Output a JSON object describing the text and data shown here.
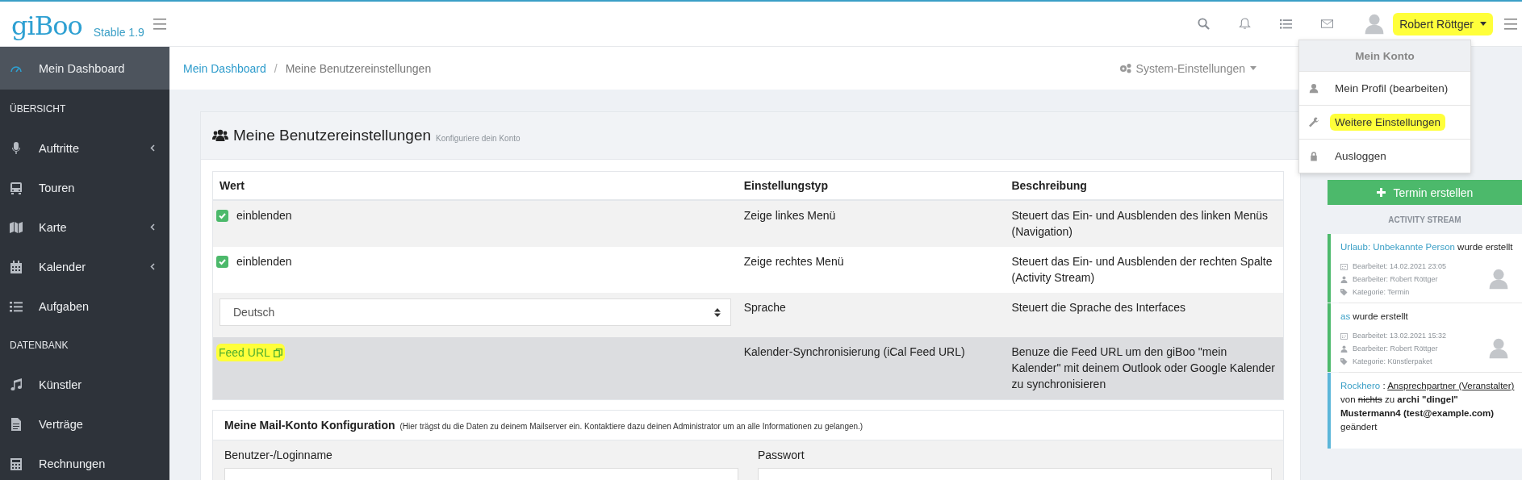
{
  "header": {
    "logo": "giBoo",
    "version": "Stable 1.9",
    "user_name": "Robert Röttger",
    "user_highlighted": true
  },
  "sidebar": {
    "items": [
      {
        "kind": "item",
        "label": "Mein Dashboard",
        "selected": true,
        "expandable": false
      },
      {
        "kind": "section",
        "label": "ÜBERSICHT"
      },
      {
        "kind": "item",
        "label": "Auftritte",
        "selected": false,
        "expandable": true
      },
      {
        "kind": "item",
        "label": "Touren",
        "selected": false,
        "expandable": false
      },
      {
        "kind": "item",
        "label": "Karte",
        "selected": false,
        "expandable": true
      },
      {
        "kind": "item",
        "label": "Kalender",
        "selected": false,
        "expandable": true
      },
      {
        "kind": "item",
        "label": "Aufgaben",
        "selected": false,
        "expandable": false
      },
      {
        "kind": "section",
        "label": "DATENBANK"
      },
      {
        "kind": "item",
        "label": "Künstler",
        "selected": false,
        "expandable": false
      },
      {
        "kind": "item",
        "label": "Verträge",
        "selected": false,
        "expandable": false
      },
      {
        "kind": "item",
        "label": "Rechnungen",
        "selected": false,
        "expandable": false
      }
    ]
  },
  "breadcrumb": {
    "items": [
      "Mein Dashboard",
      "Meine Benutzereinstellungen"
    ],
    "separator": "/",
    "menu": "System-Einstellungen"
  },
  "settings_card": {
    "title": "Meine Benutzereinstellungen",
    "subtitle": "Konfiguriere dein Konto",
    "table": {
      "columns": [
        "Wert",
        "Einstellungstyp",
        "Beschreibung"
      ],
      "rows": [
        {
          "kind": "checkbox",
          "checked": true,
          "value": "einblenden",
          "type": "Zeige linkes Menü",
          "description": "Steuert das Ein- und Ausblenden des linken Menüs (Navigation)",
          "hovered": false
        },
        {
          "kind": "checkbox",
          "checked": true,
          "value": "einblenden",
          "type": "Zeige rechtes Menü",
          "description": "Steuert das Ein- und Ausblenden der rechten Spalte (Activity Stream)",
          "hovered": false
        },
        {
          "kind": "select",
          "value": "Deutsch",
          "type": "Sprache",
          "description": "Steuert die Sprache des Interfaces",
          "hovered": false
        },
        {
          "kind": "link",
          "value": "Feed URL",
          "highlighted": true,
          "type": "Kalender-Synchronisierung (iCal Feed URL)",
          "description": "Benuze die Feed URL um den giBoo \"mein Kalender\" mit deinem Outlook oder Google Kalender zu synchronisieren",
          "hovered": true
        }
      ]
    }
  },
  "mail_card": {
    "title": "Meine Mail-Konto Konfiguration",
    "note": "(Hier trägst du die Daten zu deinem Mailserver ein. Kontaktiere dazu deinen Administrator um an alle Informationen zu gelangen.)",
    "fields": [
      {
        "label": "Benutzer-/Loginname"
      },
      {
        "label": "Passwort"
      }
    ]
  },
  "account_menu": {
    "title": "Mein Konto",
    "items": [
      {
        "label": "Mein Profil (bearbeiten)",
        "highlighted": false
      },
      {
        "label": "Weitere Einstellungen",
        "highlighted": true
      },
      {
        "label": "Ausloggen",
        "highlighted": false
      }
    ]
  },
  "right_panel": {
    "button": "Termin erstellen",
    "stream_title": "ACTIVITY STREAM",
    "activities": [
      {
        "color": "#4cb96b",
        "parts": [
          {
            "kind": "link",
            "text": "Urlaub: Unbekannte Person"
          },
          {
            "kind": "plain",
            "text": " wurde erstellt"
          }
        ],
        "meta": [
          "Bearbeitet: 14.02.2021 23:05",
          "Bearbeiter: Robert Röttger",
          "Kategorie: Termin"
        ]
      },
      {
        "color": "#4cb96b",
        "parts": [
          {
            "kind": "link",
            "text": "as"
          },
          {
            "kind": "plain",
            "text": " wurde erstellt"
          }
        ],
        "meta": [
          "Bearbeitet: 13.02.2021 15:32",
          "Bearbeiter: Robert Röttger",
          "Kategorie: Künstlerpaket"
        ]
      },
      {
        "color": "#5bb6d9",
        "parts": [
          {
            "kind": "link",
            "text": "Rockhero"
          },
          {
            "kind": "plain",
            "text": " : "
          },
          {
            "kind": "underline",
            "text": "Ansprechpartner (Veranstalter)"
          },
          {
            "kind": "plain",
            "text": " von "
          },
          {
            "kind": "strike",
            "text": "nichts"
          },
          {
            "kind": "plain",
            "text": " zu "
          },
          {
            "kind": "bold",
            "text": "archi \"dingel\" Mustermann4 (test@example.com)"
          },
          {
            "kind": "plain",
            "text": " geändert"
          }
        ]
      }
    ]
  }
}
